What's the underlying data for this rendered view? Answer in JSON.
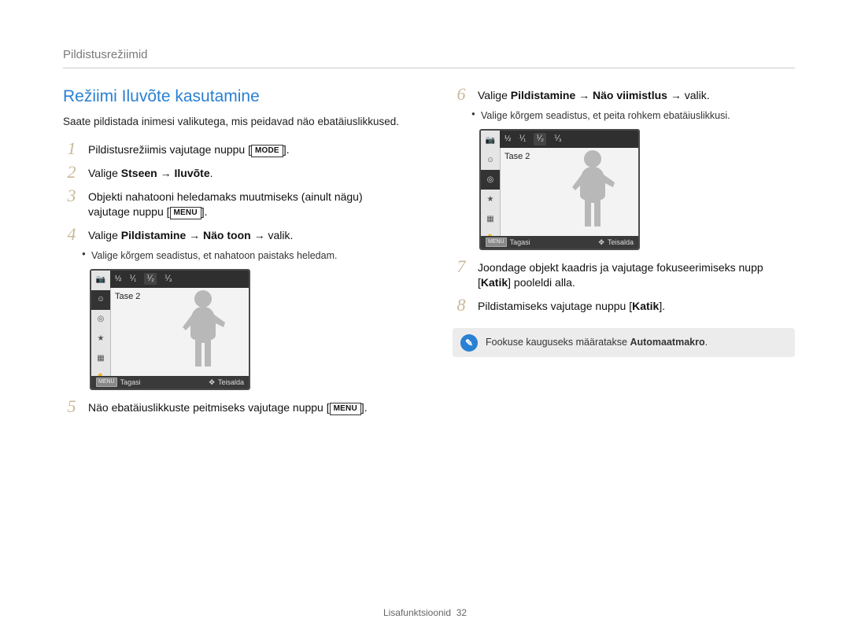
{
  "breadcrumb": "Pildistusrežiimid",
  "heading": "Režiimi Iluvõte kasutamine",
  "intro": "Saate pildistada inimesi valikutega, mis peidavad näo ebatäiuslikkused.",
  "steps": {
    "s1": {
      "num": "1",
      "pre": "Pildistusrežiimis vajutage nuppu [",
      "btn": "MODE",
      "post": "]."
    },
    "s2": {
      "num": "2",
      "pre": "Valige ",
      "b1": "Stseen",
      "arrow": " → ",
      "b2": "Iluvõte",
      "post": "."
    },
    "s3": {
      "num": "3",
      "line1": "Objekti nahatooni heledamaks muutmiseks (ainult nägu)",
      "line2_pre": "vajutage nuppu [",
      "btn": "MENU",
      "line2_post": "]."
    },
    "s4": {
      "num": "4",
      "pre": "Valige ",
      "b1": "Pildistamine",
      "arrow1": " → ",
      "b2": "Näo toon",
      "arrow2": " → valik.",
      "sub": "Valige kõrgem seadistus, et nahatoon paistaks heledam."
    },
    "s5": {
      "num": "5",
      "pre": "Näo ebatäiuslikkuste peitmiseks vajutage nuppu [",
      "btn": "MENU",
      "post": "]."
    },
    "s6": {
      "num": "6",
      "pre": "Valige ",
      "b1": "Pildistamine",
      "arrow1": " → ",
      "b2": "Näo viimistlus",
      "arrow2": " → valik.",
      "sub": "Valige kõrgem seadistus, et peita rohkem ebatäiuslikkusi."
    },
    "s7": {
      "num": "7",
      "line1": "Joondage objekt kaadris ja vajutage fokuseerimiseks nupp",
      "line2_pre": "[",
      "b1": "Katik",
      "line2_post": "] pooleldi alla."
    },
    "s8": {
      "num": "8",
      "pre": "Pildistamiseks vajutage nuppu [",
      "b1": "Katik",
      "post": "]."
    }
  },
  "lcd": {
    "level_caption": "Tase 2",
    "levels": [
      "½",
      "⅟₁",
      "⅟₂",
      "⅟₃"
    ],
    "back_btn": "MENU",
    "back_label": "Tagasi",
    "move_icon": "✥",
    "move_label": "Teisalda"
  },
  "note": {
    "icon": "✎",
    "text_pre": "Fookuse kauguseks määratakse ",
    "text_bold": "Automaatmakro",
    "text_post": "."
  },
  "footer_label": "Lisafunktsioonid",
  "footer_page": "32"
}
